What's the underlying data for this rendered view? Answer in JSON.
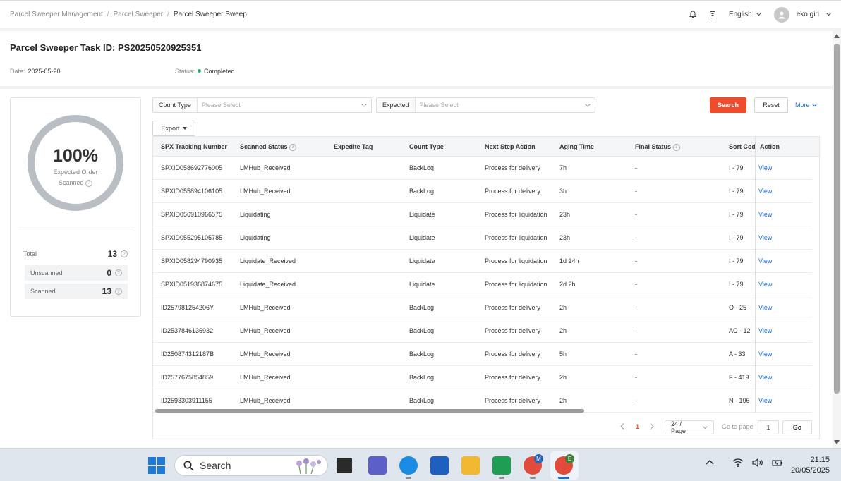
{
  "breadcrumb": [
    "Parcel Sweeper Management",
    "Parcel Sweeper",
    "Parcel Sweeper Sweep"
  ],
  "topbar": {
    "language": "English",
    "username": "eko.giri"
  },
  "task": {
    "title": "Parcel Sweeper Task ID: PS20250520925351",
    "date_label": "Date:",
    "date_value": "2025-05-20",
    "status_label": "Status:",
    "status_value": "Completed",
    "status_color": "#2db36d"
  },
  "summary": {
    "percent": "100%",
    "percent_value": 100,
    "ring_label_1": "Expected Order",
    "ring_label_2": "Scanned",
    "total_label": "Total",
    "total_value": "13",
    "unscanned_label": "Unscanned",
    "unscanned_value": "0",
    "scanned_label": "Scanned",
    "scanned_value": "13"
  },
  "filters": {
    "count_type_label": "Count Type",
    "count_type_placeholder": "Please Select",
    "expected_label": "Expected",
    "expected_placeholder": "Please Select",
    "search": "Search",
    "reset": "Reset",
    "more": "More",
    "export": "Export"
  },
  "table": {
    "headers": [
      "SPX Tracking Number",
      "Scanned Status",
      "Expedite Tag",
      "Count Type",
      "Next Step Action",
      "Aging Time",
      "Final Status",
      "Sort Code",
      "Action"
    ],
    "rows": [
      [
        "SPXID058692776005",
        "LMHub_Received",
        "",
        "BackLog",
        "Process for delivery",
        "7h",
        "-",
        "I - 79",
        "View"
      ],
      [
        "SPXID055894106105",
        "LMHub_Received",
        "",
        "BackLog",
        "Process for delivery",
        "3h",
        "-",
        "I - 79",
        "View"
      ],
      [
        "SPXID056910966575",
        "Liquidating",
        "",
        "Liquidate",
        "Process for liquidation",
        "23h",
        "-",
        "I - 79",
        "View"
      ],
      [
        "SPXID055295105785",
        "Liquidating",
        "",
        "Liquidate",
        "Process for liquidation",
        "23h",
        "-",
        "I - 79",
        "View"
      ],
      [
        "SPXID058294790935",
        "Liquidate_Received",
        "",
        "Liquidate",
        "Process for liquidation",
        "1d 24h",
        "-",
        "I - 79",
        "View"
      ],
      [
        "SPXID051936874675",
        "Liquidate_Received",
        "",
        "Liquidate",
        "Process for liquidation",
        "2d 2h",
        "-",
        "I - 79",
        "View"
      ],
      [
        "ID257981254206Y",
        "LMHub_Received",
        "",
        "BackLog",
        "Process for delivery",
        "2h",
        "-",
        "O - 25",
        "View"
      ],
      [
        "ID2537846135932",
        "LMHub_Received",
        "",
        "BackLog",
        "Process for delivery",
        "2h",
        "-",
        "AC - 12",
        "View"
      ],
      [
        "ID250874312187B",
        "LMHub_Received",
        "",
        "BackLog",
        "Process for delivery",
        "5h",
        "-",
        "A - 33",
        "View"
      ],
      [
        "ID2577675854859",
        "LMHub_Received",
        "",
        "BackLog",
        "Process for delivery",
        "2h",
        "-",
        "F - 419",
        "View"
      ],
      [
        "ID2593303911155",
        "LMHub_Received",
        "",
        "BackLog",
        "Process for delivery",
        "2h",
        "-",
        "N - 106",
        "View"
      ]
    ]
  },
  "pager": {
    "current": "1",
    "page_size": "24 / Page",
    "goto_label": "Go to page",
    "goto_value": "1",
    "go": "Go"
  },
  "taskbar": {
    "search": "Search",
    "time": "21:15",
    "date": "20/05/2025"
  }
}
